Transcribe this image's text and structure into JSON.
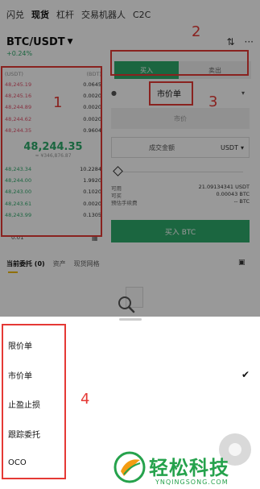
{
  "top_tabs": [
    "闪兑",
    "现货",
    "杠杆",
    "交易机器人",
    "C2C"
  ],
  "pair": {
    "name": "BTC/USDT",
    "change": "+0.24%"
  },
  "order_book": {
    "head_left": "(USDT)",
    "head_right": "(BDT)",
    "asks": [
      {
        "price": "48,245.19",
        "qty": "0.0645"
      },
      {
        "price": "48,245.16",
        "qty": "0.0020"
      },
      {
        "price": "48,244.89",
        "qty": "0.0020"
      },
      {
        "price": "48,244.62",
        "qty": "0.0020"
      },
      {
        "price": "48,244.35",
        "qty": "0.9604"
      }
    ],
    "last_price": "48,244.35",
    "last_fiat": "≈ ¥346,876.87",
    "bids": [
      {
        "price": "48,243.34",
        "qty": "10.2284"
      },
      {
        "price": "48,244.00",
        "qty": "1.9920"
      },
      {
        "price": "48,243.00",
        "qty": "0.1020"
      },
      {
        "price": "48,243.61",
        "qty": "0.0020"
      },
      {
        "price": "48,243.99",
        "qty": "0.1305"
      }
    ],
    "precision": "0.01"
  },
  "trade": {
    "buy_label": "买入",
    "sell_label": "卖出",
    "order_type": "市价单",
    "price_placeholder": "市价",
    "amount_label": "成交金额",
    "amount_unit": "USDT",
    "info": [
      {
        "label": "可用",
        "value": "21.09134341 USDT"
      },
      {
        "label": "可买",
        "value": "0.00043 BTC"
      },
      {
        "label": "预估手续费",
        "value": "-- BTC"
      }
    ],
    "buy_button": "买入 BTC"
  },
  "orders_tabs": [
    "当前委托 (0)",
    "资产",
    "现货网格"
  ],
  "sheet_items": [
    {
      "label": "限价单",
      "selected": false
    },
    {
      "label": "市价单",
      "selected": true
    },
    {
      "label": "止盈止损",
      "selected": false
    },
    {
      "label": "跟踪委托",
      "selected": false
    },
    {
      "label": "OCO",
      "selected": false
    }
  ],
  "annotations": [
    "1",
    "2",
    "3",
    "4"
  ],
  "watermark": {
    "text": "轻松科技",
    "url": "YNQINGSONG.COM"
  },
  "colors": {
    "green": "#2eaa6b",
    "red": "#e2506a",
    "annotation": "#e53935"
  }
}
